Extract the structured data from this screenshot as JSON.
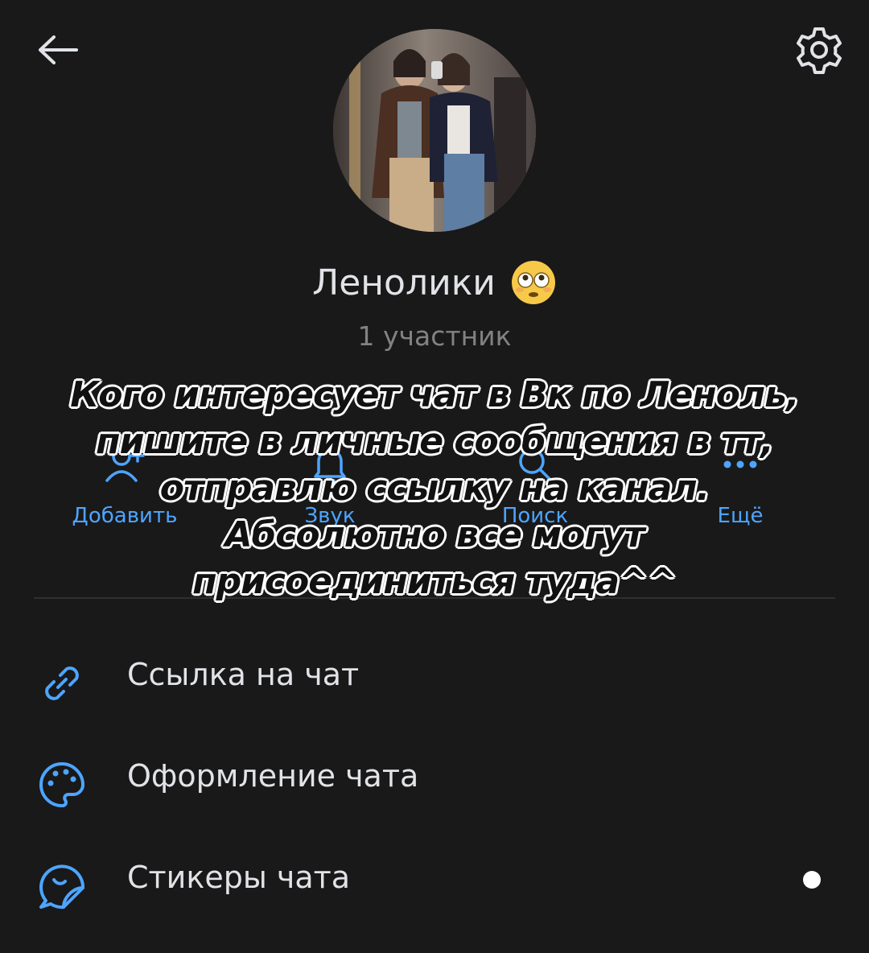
{
  "header": {
    "back_icon": "arrow-left-icon",
    "settings_icon": "gear-icon"
  },
  "profile": {
    "title": "Ленолики",
    "title_emoji": "flushed-face-emoji",
    "subtitle": "1 участник"
  },
  "actions": [
    {
      "label": "Добавить",
      "icon": "add-user-icon"
    },
    {
      "label": "Звук",
      "icon": "bell-icon"
    },
    {
      "label": "Поиск",
      "icon": "search-icon"
    },
    {
      "label": "Ещё",
      "icon": "more-icon"
    }
  ],
  "menu": [
    {
      "label": "Ссылка на чат",
      "icon": "link-icon"
    },
    {
      "label": "Оформление чата",
      "icon": "palette-icon"
    },
    {
      "label": "Стикеры чата",
      "icon": "sticker-icon",
      "badge": "new-dot"
    }
  ],
  "overlay": {
    "lines": [
      "Кого интересует чат в Вк по Леноль,",
      "пишите в личные сообщения в тт,",
      "отправлю ссылку на канал.",
      "Абсолютно все могут",
      "присоединиться туда^^"
    ]
  },
  "colors": {
    "background": "#19191a",
    "accent": "#4da5ff",
    "text_primary": "#e1e3e6",
    "text_secondary": "#828282"
  }
}
